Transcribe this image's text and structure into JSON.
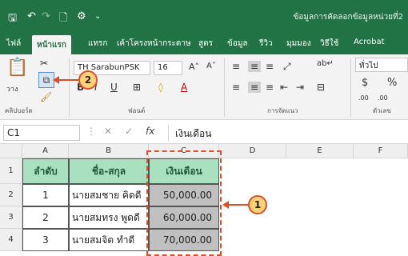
{
  "titlebar": {
    "title": "ข้อมูลการคัดลอกข้อมูลหน่วยที่2"
  },
  "tabs": [
    "ไฟล์",
    "หน้าแรก",
    "แทรก",
    "เค้าโครงหน้ากระดาษ",
    "สูตร",
    "ข้อมูล",
    "รีวิว",
    "มุมมอง",
    "วิธีใช้",
    "Acrobat"
  ],
  "ribbon": {
    "paste_label": "วาง",
    "clipboard_label": "คลิปบอร์ด",
    "font_name": "TH SarabunPSK",
    "font_size": "16",
    "font_group_label": "ฟอนต์",
    "alignment_label": "การจัดแนว",
    "number_format": "ทั่วไป",
    "number_label": "ตัวเลข",
    "currency_symbol": "$",
    "percent_symbol": "%",
    "inc_decimal": ".00",
    "dec_decimal": ".00"
  },
  "formula_bar": {
    "name_box": "C1",
    "fx": "fx",
    "value": "เงินเดือน"
  },
  "grid": {
    "columns": [
      "A",
      "B",
      "C",
      "D",
      "E",
      "F"
    ],
    "rows": [
      "1",
      "2",
      "3",
      "4"
    ],
    "headers": [
      "ลำดับ",
      "ชื่อ-สกุล",
      "เงินเดือน"
    ],
    "data": [
      [
        "1",
        "นายสมชาย คิดดี",
        "50,000.00"
      ],
      [
        "2",
        "นายสมทรง พูดดี",
        "60,000.00"
      ],
      [
        "3",
        "นายสมจิต ทำดี",
        "70,000.00"
      ]
    ]
  },
  "callouts": [
    "1",
    "2"
  ],
  "colors": {
    "excel_green": "#217346",
    "header_fill": "#a8e0c0",
    "selection": "#d9502a",
    "callout_fill": "#ffd27a"
  }
}
